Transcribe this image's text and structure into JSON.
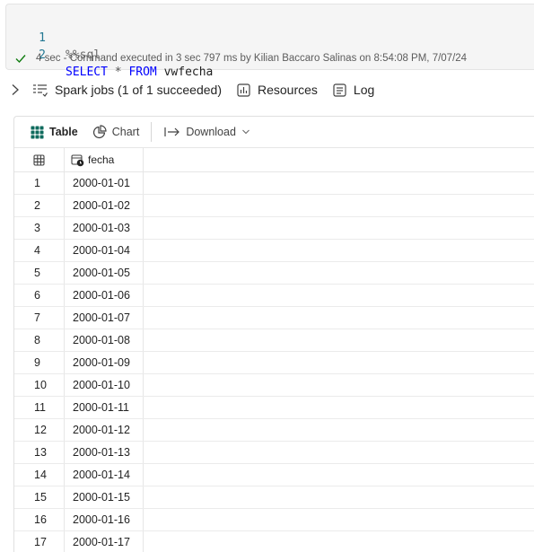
{
  "code": {
    "lines": [
      {
        "number": "1",
        "magic": "%%sql"
      },
      {
        "number": "2",
        "keyword1": "SELECT",
        "operator": "*",
        "keyword2": "FROM",
        "identifier": "vwfecha"
      }
    ]
  },
  "status": {
    "text": "4 sec - Command executed in 3 sec 797 ms by Kilian Baccaro Salinas on 8:54:08 PM, 7/07/24",
    "color": "#107c10"
  },
  "output_bar": {
    "spark_jobs": "Spark jobs (1 of 1 succeeded)",
    "resources": "Resources",
    "log": "Log"
  },
  "tabs": {
    "table": "Table",
    "chart": "Chart",
    "download": "Download"
  },
  "table": {
    "column_header": "fecha",
    "rows": [
      {
        "idx": "1",
        "fecha": "2000-01-01"
      },
      {
        "idx": "2",
        "fecha": "2000-01-02"
      },
      {
        "idx": "3",
        "fecha": "2000-01-03"
      },
      {
        "idx": "4",
        "fecha": "2000-01-04"
      },
      {
        "idx": "5",
        "fecha": "2000-01-05"
      },
      {
        "idx": "6",
        "fecha": "2000-01-06"
      },
      {
        "idx": "7",
        "fecha": "2000-01-07"
      },
      {
        "idx": "8",
        "fecha": "2000-01-08"
      },
      {
        "idx": "9",
        "fecha": "2000-01-09"
      },
      {
        "idx": "10",
        "fecha": "2000-01-10"
      },
      {
        "idx": "11",
        "fecha": "2000-01-11"
      },
      {
        "idx": "12",
        "fecha": "2000-01-12"
      },
      {
        "idx": "13",
        "fecha": "2000-01-13"
      },
      {
        "idx": "14",
        "fecha": "2000-01-14"
      },
      {
        "idx": "15",
        "fecha": "2000-01-15"
      },
      {
        "idx": "16",
        "fecha": "2000-01-16"
      },
      {
        "idx": "17",
        "fecha": "2000-01-17"
      }
    ]
  },
  "icons": {
    "status": "checkmark-icon",
    "expand": "chevron-right-icon",
    "spark_jobs": "spark-jobs-list-icon",
    "resources": "resources-chart-icon",
    "log": "log-icon",
    "table_tab": "table-grid-icon",
    "chart_tab": "pie-chart-icon",
    "download": "arrow-right-to-line-icon",
    "download_menu": "chevron-down-icon",
    "row_index_header": "table-grid-icon",
    "column_type": "date-column-icon"
  }
}
